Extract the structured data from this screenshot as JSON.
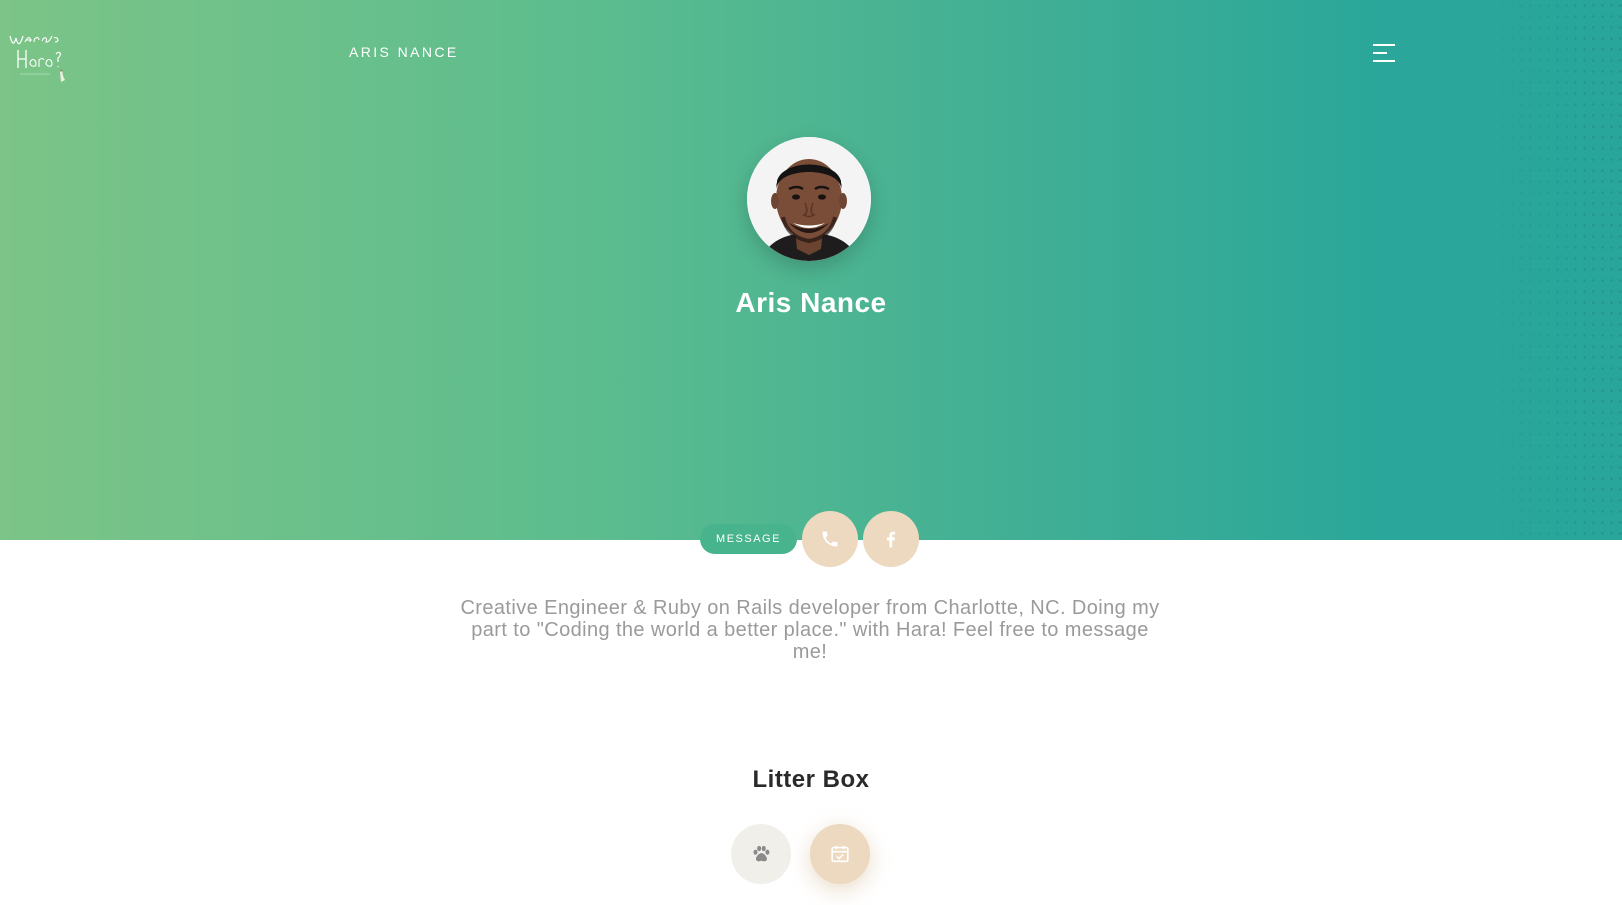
{
  "header": {
    "logo_text": "Where's Hara?",
    "brand": "ARIS NANCE"
  },
  "profile": {
    "name": "Aris Nance",
    "message_label": "MESSAGE",
    "bio": "Creative Engineer & Ruby on Rails developer from Charlotte, NC. Doing my part to \"Coding the world a better place.\" with Hara! Feel free to message me!"
  },
  "section": {
    "title": "Litter Box"
  },
  "icons": {
    "menu": "hamburger-menu-icon",
    "phone": "phone-icon",
    "facebook": "facebook-icon",
    "paw": "paw-icon",
    "calendar": "calendar-check-icon"
  },
  "colors": {
    "gradient_start": "#7cc487",
    "gradient_end": "#29a69b",
    "message_button": "#48b48e",
    "accent_beige": "#ecd9bf"
  }
}
